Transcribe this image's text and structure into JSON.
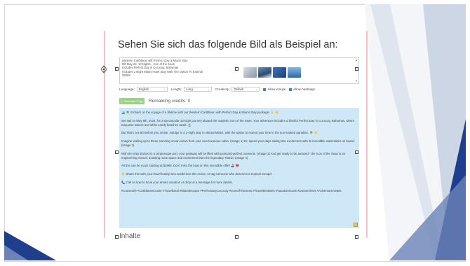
{
  "slide": {
    "title": "Sehen Sie sich das folgende Bild als Beispiel an:",
    "next_label": "Inhalte"
  },
  "input": {
    "lines": [
      "Western Caribbean with Perfect Day & Miami Stay",
      "9th May 24, 10 Nights - Icon of the Seas",
      "Includes Perfect Day in Cococay, Bahamas",
      "Includes 2 Night Miami Hotel Stay With The Option To Extend!",
      "$2999"
    ]
  },
  "options": {
    "language_label": "Language:",
    "language_value": "English",
    "length_label": "Length:",
    "length_value": "Long",
    "creativity_label": "Creativity:",
    "creativity_value": "Default",
    "allow_emojis": "Allow emojis",
    "allow_hashtags": "Allow hashtags"
  },
  "generate": {
    "button_label": "✓ Generate Copy",
    "credits": "Remaining credits: 0"
  },
  "output": {
    "paragraphs": [
      "🛳️ 🌴 Embark on the voyage of a lifetime with our Western Caribbean with Perfect Day & Miami Stay package! 🍹 ☀️",
      "Set sail on May 9th, 2024, for a spectacular 10-night journey aboard the majestic Icon of the Seas. Your adventure includes a blissful Perfect Day in Cococay, Bahamas, where turquoise waters and white sandy beaches await. 🏝️",
      "But that's not all! Before you cruise, indulge in a 2-night stay in vibrant Miami, with the option to extend your time in the sun-soaked paradise. 🌴 ☀️",
      "Imagine waking up to these stunning ocean views from your own luxurious cabin. (Image 1) Or, spend your days sliding into excitement with its incredible waterslides on board. (Image 2)",
      "With the ship docked in a picturesque port, your getaway will be filled with postcard-perfect moments. (Image 3) And get ready to be amazed - the Icon of the Seas is an engineering marvel, boasting more space and excitement than the legendary Titanic! (Image 4)",
      "All this can be yours starting at $2999. Don't miss the boat on this incredible offer! 🚢 ❤️",
      "👉 Share this with your travel buddy who would love this cruise, or tag someone who deserves a tropical escape!",
      "📞 Call us now to book your dream vacation or drop us a message for more details.",
      "#CruiseLife #CaribbeanCruise #TravelDeal #MiamiEscape #PerfectDayCococay #IconOfTheSeas #TravelBestBets #VacationGoals #DreamViews #AdventureAwaits"
    ]
  },
  "colors": {
    "output_bg": "#cfe8f7",
    "button_bg": "#9fcf8a",
    "deco_blue": "#1f3f8c"
  },
  "icons": [
    "rotate-handle-icon",
    "copy-icon",
    "chevron-down-icon",
    "checkbox-icon"
  ]
}
